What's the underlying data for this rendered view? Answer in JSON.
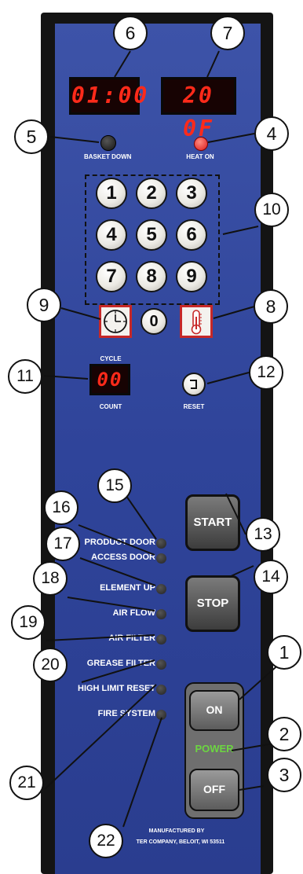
{
  "displays": {
    "left": "01:00",
    "right": "20 0F"
  },
  "indicators": {
    "basket_down": "BASKET DOWN",
    "heat_on": "HEAT ON"
  },
  "keypad": [
    "1",
    "2",
    "3",
    "4",
    "5",
    "6",
    "7",
    "8",
    "9",
    "0"
  ],
  "cycle_count": {
    "top_label": "CYCLE",
    "display": "00",
    "bottom_label": "COUNT",
    "reset_label": "RESET"
  },
  "status_labels": [
    "PRODUCT DOOR",
    "ACCESS DOOR",
    "ELEMENT UP",
    "AIR FLOW",
    "AIR FILTER",
    "GREASE FILTER",
    "HIGH LIMIT RESET",
    "FIRE SYSTEM"
  ],
  "buttons": {
    "start": "START",
    "stop": "STOP",
    "on": "ON",
    "power": "POWER",
    "off": "OFF"
  },
  "footer": {
    "line1": "MANUFACTURED BY",
    "line2": "TER COMPANY, BELOIT, WI 53511"
  },
  "callouts": [
    "1",
    "2",
    "3",
    "4",
    "5",
    "6",
    "7",
    "8",
    "9",
    "10",
    "11",
    "12",
    "13",
    "14",
    "15",
    "16",
    "17",
    "18",
    "19",
    "20",
    "21",
    "22"
  ],
  "colors": {
    "panel": "#3a4fa3",
    "led_red": "#ff2a1a",
    "heat_on_light": "#ee2222",
    "thermometer_border": "#c62828",
    "power_green": "#6cd641"
  }
}
